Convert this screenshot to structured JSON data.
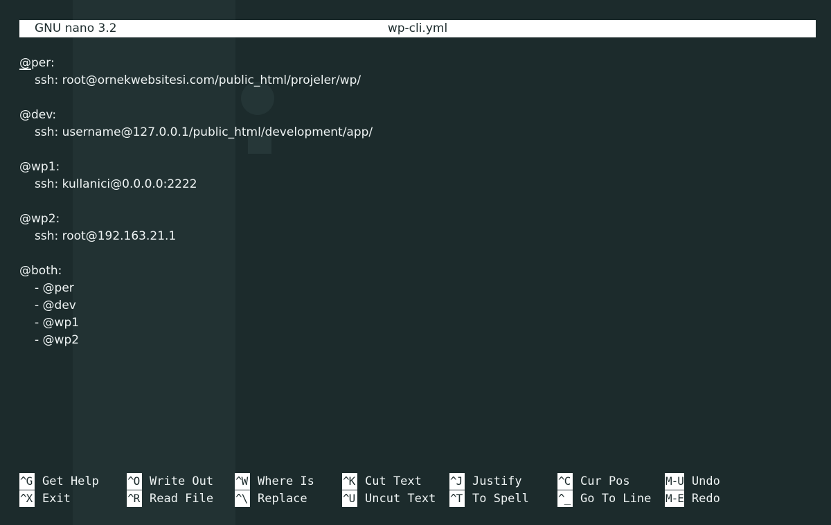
{
  "titlebar": {
    "version": "GNU nano 3.2",
    "filename": "wp-cli.yml"
  },
  "editor": {
    "lines": [
      {
        "text": "@per:",
        "indent": false,
        "cursor": true
      },
      {
        "text": "ssh: root@ornekwebsitesi.com/public_html/projeler/wp/",
        "indent": true
      },
      {
        "text": "",
        "indent": false
      },
      {
        "text": "@dev:",
        "indent": false
      },
      {
        "text": "ssh: username@127.0.0.1/public_html/development/app/",
        "indent": true
      },
      {
        "text": "",
        "indent": false
      },
      {
        "text": "@wp1:",
        "indent": false
      },
      {
        "text": "ssh: kullanici@0.0.0.0:2222",
        "indent": true
      },
      {
        "text": "",
        "indent": false
      },
      {
        "text": "@wp2:",
        "indent": false
      },
      {
        "text": "ssh: root@192.163.21.1",
        "indent": true
      },
      {
        "text": "",
        "indent": false
      },
      {
        "text": "@both:",
        "indent": false
      },
      {
        "text": "- @per",
        "indent": true
      },
      {
        "text": "- @dev",
        "indent": true
      },
      {
        "text": "- @wp1",
        "indent": true
      },
      {
        "text": "- @wp2",
        "indent": true
      }
    ]
  },
  "shortcuts": {
    "row1": [
      {
        "key": "^G",
        "label": "Get Help"
      },
      {
        "key": "^O",
        "label": "Write Out"
      },
      {
        "key": "^W",
        "label": "Where Is"
      },
      {
        "key": "^K",
        "label": "Cut Text"
      },
      {
        "key": "^J",
        "label": "Justify"
      },
      {
        "key": "^C",
        "label": "Cur Pos"
      },
      {
        "key": "M-U",
        "label": "Undo"
      }
    ],
    "row2": [
      {
        "key": "^X",
        "label": "Exit"
      },
      {
        "key": "^R",
        "label": "Read File"
      },
      {
        "key": "^\\",
        "label": "Replace"
      },
      {
        "key": "^U",
        "label": "Uncut Text"
      },
      {
        "key": "^T",
        "label": "To Spell"
      },
      {
        "key": "^_",
        "label": "Go To Line"
      },
      {
        "key": "M-E",
        "label": "Redo"
      }
    ]
  },
  "colors": {
    "background": "#1c2b2c",
    "foreground": "#eef3f3",
    "inverse_bg": "#ffffff"
  }
}
